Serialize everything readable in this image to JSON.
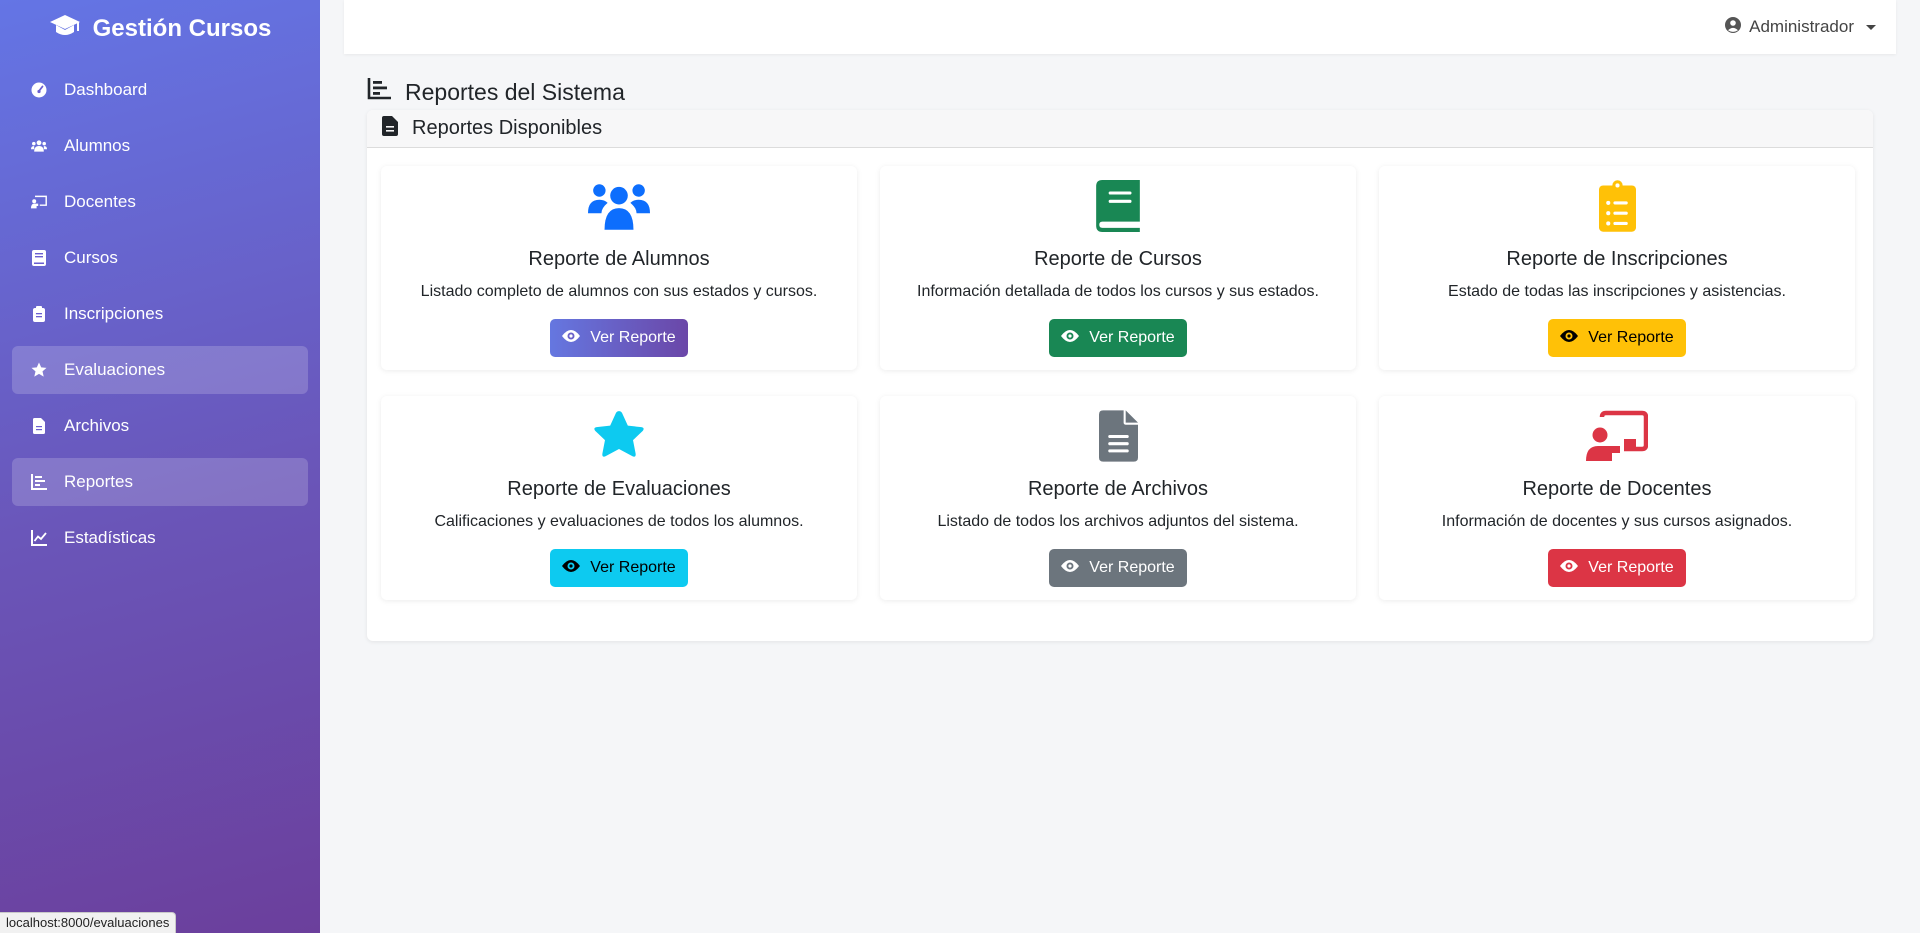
{
  "app": {
    "brand": "Gestión Cursos",
    "brand_icon": "graduation-cap-icon"
  },
  "sidebar": {
    "items": [
      {
        "label": "Dashboard",
        "icon": "gauge-icon",
        "active": false
      },
      {
        "label": "Alumnos",
        "icon": "users-icon",
        "active": false
      },
      {
        "label": "Docentes",
        "icon": "chalkboard-teacher-icon",
        "active": false
      },
      {
        "label": "Cursos",
        "icon": "book-icon",
        "active": false
      },
      {
        "label": "Inscripciones",
        "icon": "clipboard-icon",
        "active": false
      },
      {
        "label": "Evaluaciones",
        "icon": "star-icon",
        "active": true
      },
      {
        "label": "Archivos",
        "icon": "file-icon",
        "active": false
      },
      {
        "label": "Reportes",
        "icon": "chart-bar-icon",
        "active": true
      },
      {
        "label": "Estadísticas",
        "icon": "chart-line-icon",
        "active": false
      }
    ]
  },
  "topbar": {
    "user_label": "Administrador",
    "user_icon": "user-circle-icon"
  },
  "page": {
    "title": "Reportes del Sistema",
    "panel_title": "Reportes Disponibles"
  },
  "reports": [
    {
      "title": "Reporte de Alumnos",
      "description": "Listado completo de alumnos con sus estados y cursos.",
      "button": "Ver Reporte",
      "icon": "users-icon",
      "color": "#0d6efd"
    },
    {
      "title": "Reporte de Cursos",
      "description": "Información detallada de todos los cursos y sus estados.",
      "button": "Ver Reporte",
      "icon": "book-icon",
      "color": "#198754"
    },
    {
      "title": "Reporte de Inscripciones",
      "description": "Estado de todas las inscripciones y asistencias.",
      "button": "Ver Reporte",
      "icon": "clipboard-list-icon",
      "color": "#ffc107"
    },
    {
      "title": "Reporte de Evaluaciones",
      "description": "Calificaciones y evaluaciones de todos los alumnos.",
      "button": "Ver Reporte",
      "icon": "star-icon",
      "color": "#0dcaf0"
    },
    {
      "title": "Reporte de Archivos",
      "description": "Listado de todos los archivos adjuntos del sistema.",
      "button": "Ver Reporte",
      "icon": "file-alt-icon",
      "color": "#6c757d"
    },
    {
      "title": "Reporte de Docentes",
      "description": "Información de docentes y sus cursos asignados.",
      "button": "Ver Reporte",
      "icon": "chalkboard-teacher-icon",
      "color": "#dc3545"
    }
  ],
  "statusbar": {
    "url": "localhost:8000/evaluaciones"
  }
}
